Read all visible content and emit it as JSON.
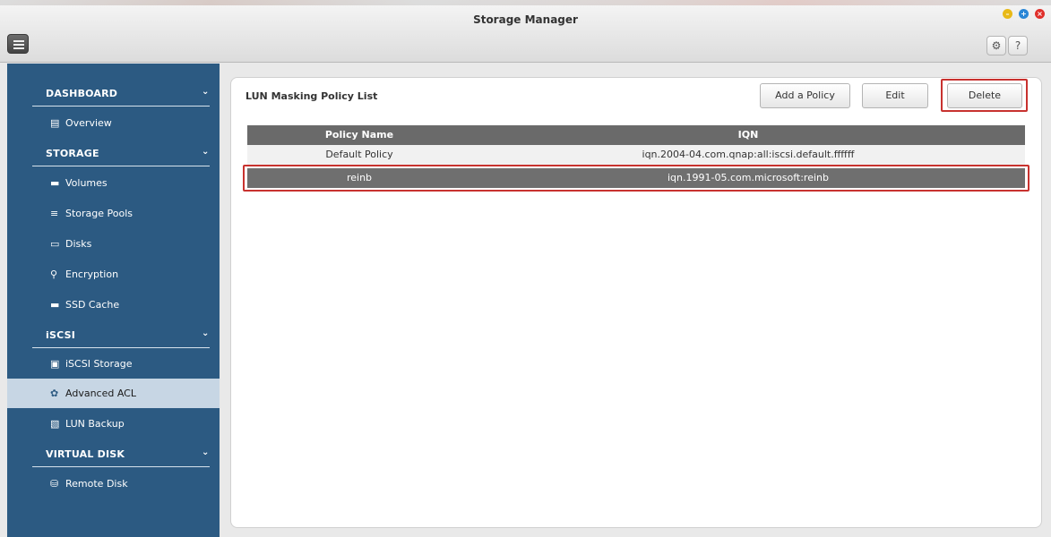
{
  "window": {
    "title": "Storage Manager"
  },
  "toolbar": {
    "settings_icon": "gear-icon",
    "help_label": "?"
  },
  "sidebar": {
    "sections": [
      {
        "label": "DASHBOARD",
        "items": [
          {
            "label": "Overview",
            "icon": "overview-icon"
          }
        ]
      },
      {
        "label": "STORAGE",
        "items": [
          {
            "label": "Volumes",
            "icon": "volume-icon"
          },
          {
            "label": "Storage Pools",
            "icon": "storage-pool-icon"
          },
          {
            "label": "Disks",
            "icon": "disk-icon"
          },
          {
            "label": "Encryption",
            "icon": "key-icon"
          },
          {
            "label": "SSD Cache",
            "icon": "ssd-icon"
          }
        ]
      },
      {
        "label": "iSCSI",
        "items": [
          {
            "label": "iSCSI Storage",
            "icon": "iscsi-storage-icon"
          },
          {
            "label": "Advanced ACL",
            "icon": "gear-icon",
            "active": true
          },
          {
            "label": "LUN Backup",
            "icon": "lun-backup-icon"
          }
        ]
      },
      {
        "label": "VIRTUAL DISK",
        "items": [
          {
            "label": "Remote Disk",
            "icon": "remote-disk-icon"
          }
        ]
      }
    ]
  },
  "main": {
    "title": "LUN Masking Policy List",
    "buttons": {
      "add": "Add a Policy",
      "edit": "Edit",
      "delete": "Delete"
    },
    "table": {
      "columns": [
        "Policy Name",
        "IQN"
      ],
      "rows": [
        {
          "policy_name": "Default Policy",
          "iqn": "iqn.2004-04.com.qnap:all:iscsi.default.ffffff"
        },
        {
          "policy_name": "reinb",
          "iqn": "iqn.1991-05.com.microsoft:reinb",
          "selected": true
        }
      ]
    }
  },
  "colors": {
    "sidebar_bg": "#2c5a82",
    "active_item_bg": "#c7d6e4",
    "highlight_border": "#c8322f",
    "table_header": "#6a6a6a"
  }
}
